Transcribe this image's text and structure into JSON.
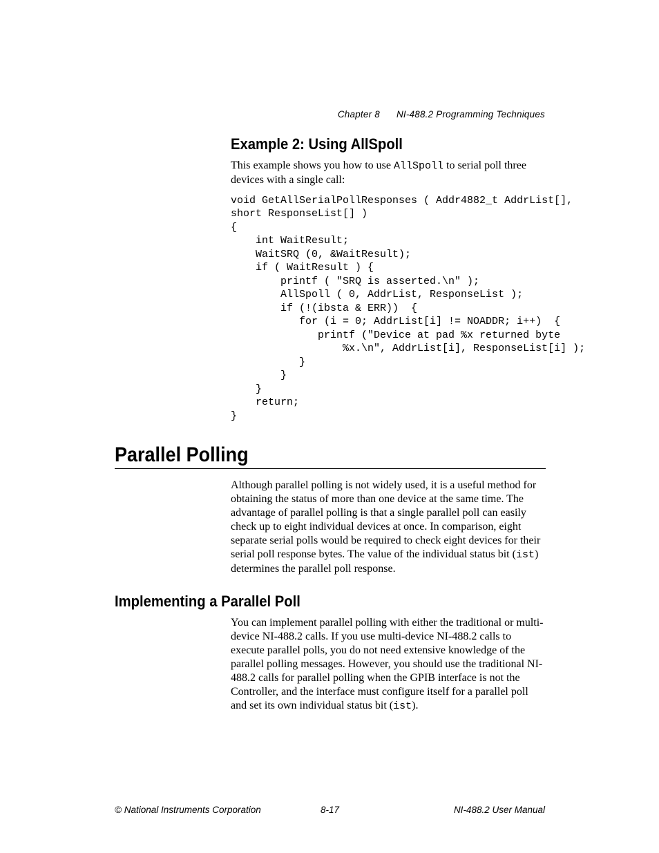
{
  "header": {
    "chapter": "Chapter 8",
    "title": "NI-488.2 Programming Techniques"
  },
  "section1": {
    "heading": "Example 2: Using AllSpoll",
    "intro_pre": "This example shows you how to use ",
    "intro_code": "AllSpoll",
    "intro_post": " to serial poll three devices with a single call:",
    "code": "void GetAllSerialPollResponses ( Addr4882_t AddrList[],\nshort ResponseList[] )\n{\n    int WaitResult;\n    WaitSRQ (0, &WaitResult);\n    if ( WaitResult ) {\n        printf ( \"SRQ is asserted.\\n\" );\n        AllSpoll ( 0, AddrList, ResponseList );\n        if (!(ibsta & ERR))  {\n           for (i = 0; AddrList[i] != NOADDR; i++)  {\n              printf (\"Device at pad %x returned byte\n                  %x.\\n\", AddrList[i], ResponseList[i] );\n           }\n        }\n    }\n    return;\n}"
  },
  "section2": {
    "heading": "Parallel Polling",
    "para_pre": "Although parallel polling is not widely used, it is a useful method for obtaining the status of more than one device at the same time. The advantage of parallel polling is that a single parallel poll can easily check up to eight individual devices at once. In comparison, eight separate serial polls would be required to check eight devices for their serial poll response bytes. The value of the individual status bit (",
    "para_code": "ist",
    "para_post": ") determines the parallel poll response."
  },
  "section3": {
    "heading": "Implementing a Parallel Poll",
    "para_pre": "You can implement parallel polling with either the traditional or multi-device NI-488.2 calls. If you use multi-device NI-488.2 calls to execute parallel polls, you do not need extensive knowledge of the parallel polling messages. However, you should use the traditional NI-488.2 calls for parallel polling when the GPIB interface is not the Controller, and the interface must configure itself for a parallel poll and set its own individual status bit (",
    "para_code": "ist",
    "para_post": ")."
  },
  "footer": {
    "left": "© National Instruments Corporation",
    "center": "8-17",
    "right": "NI-488.2 User Manual"
  }
}
